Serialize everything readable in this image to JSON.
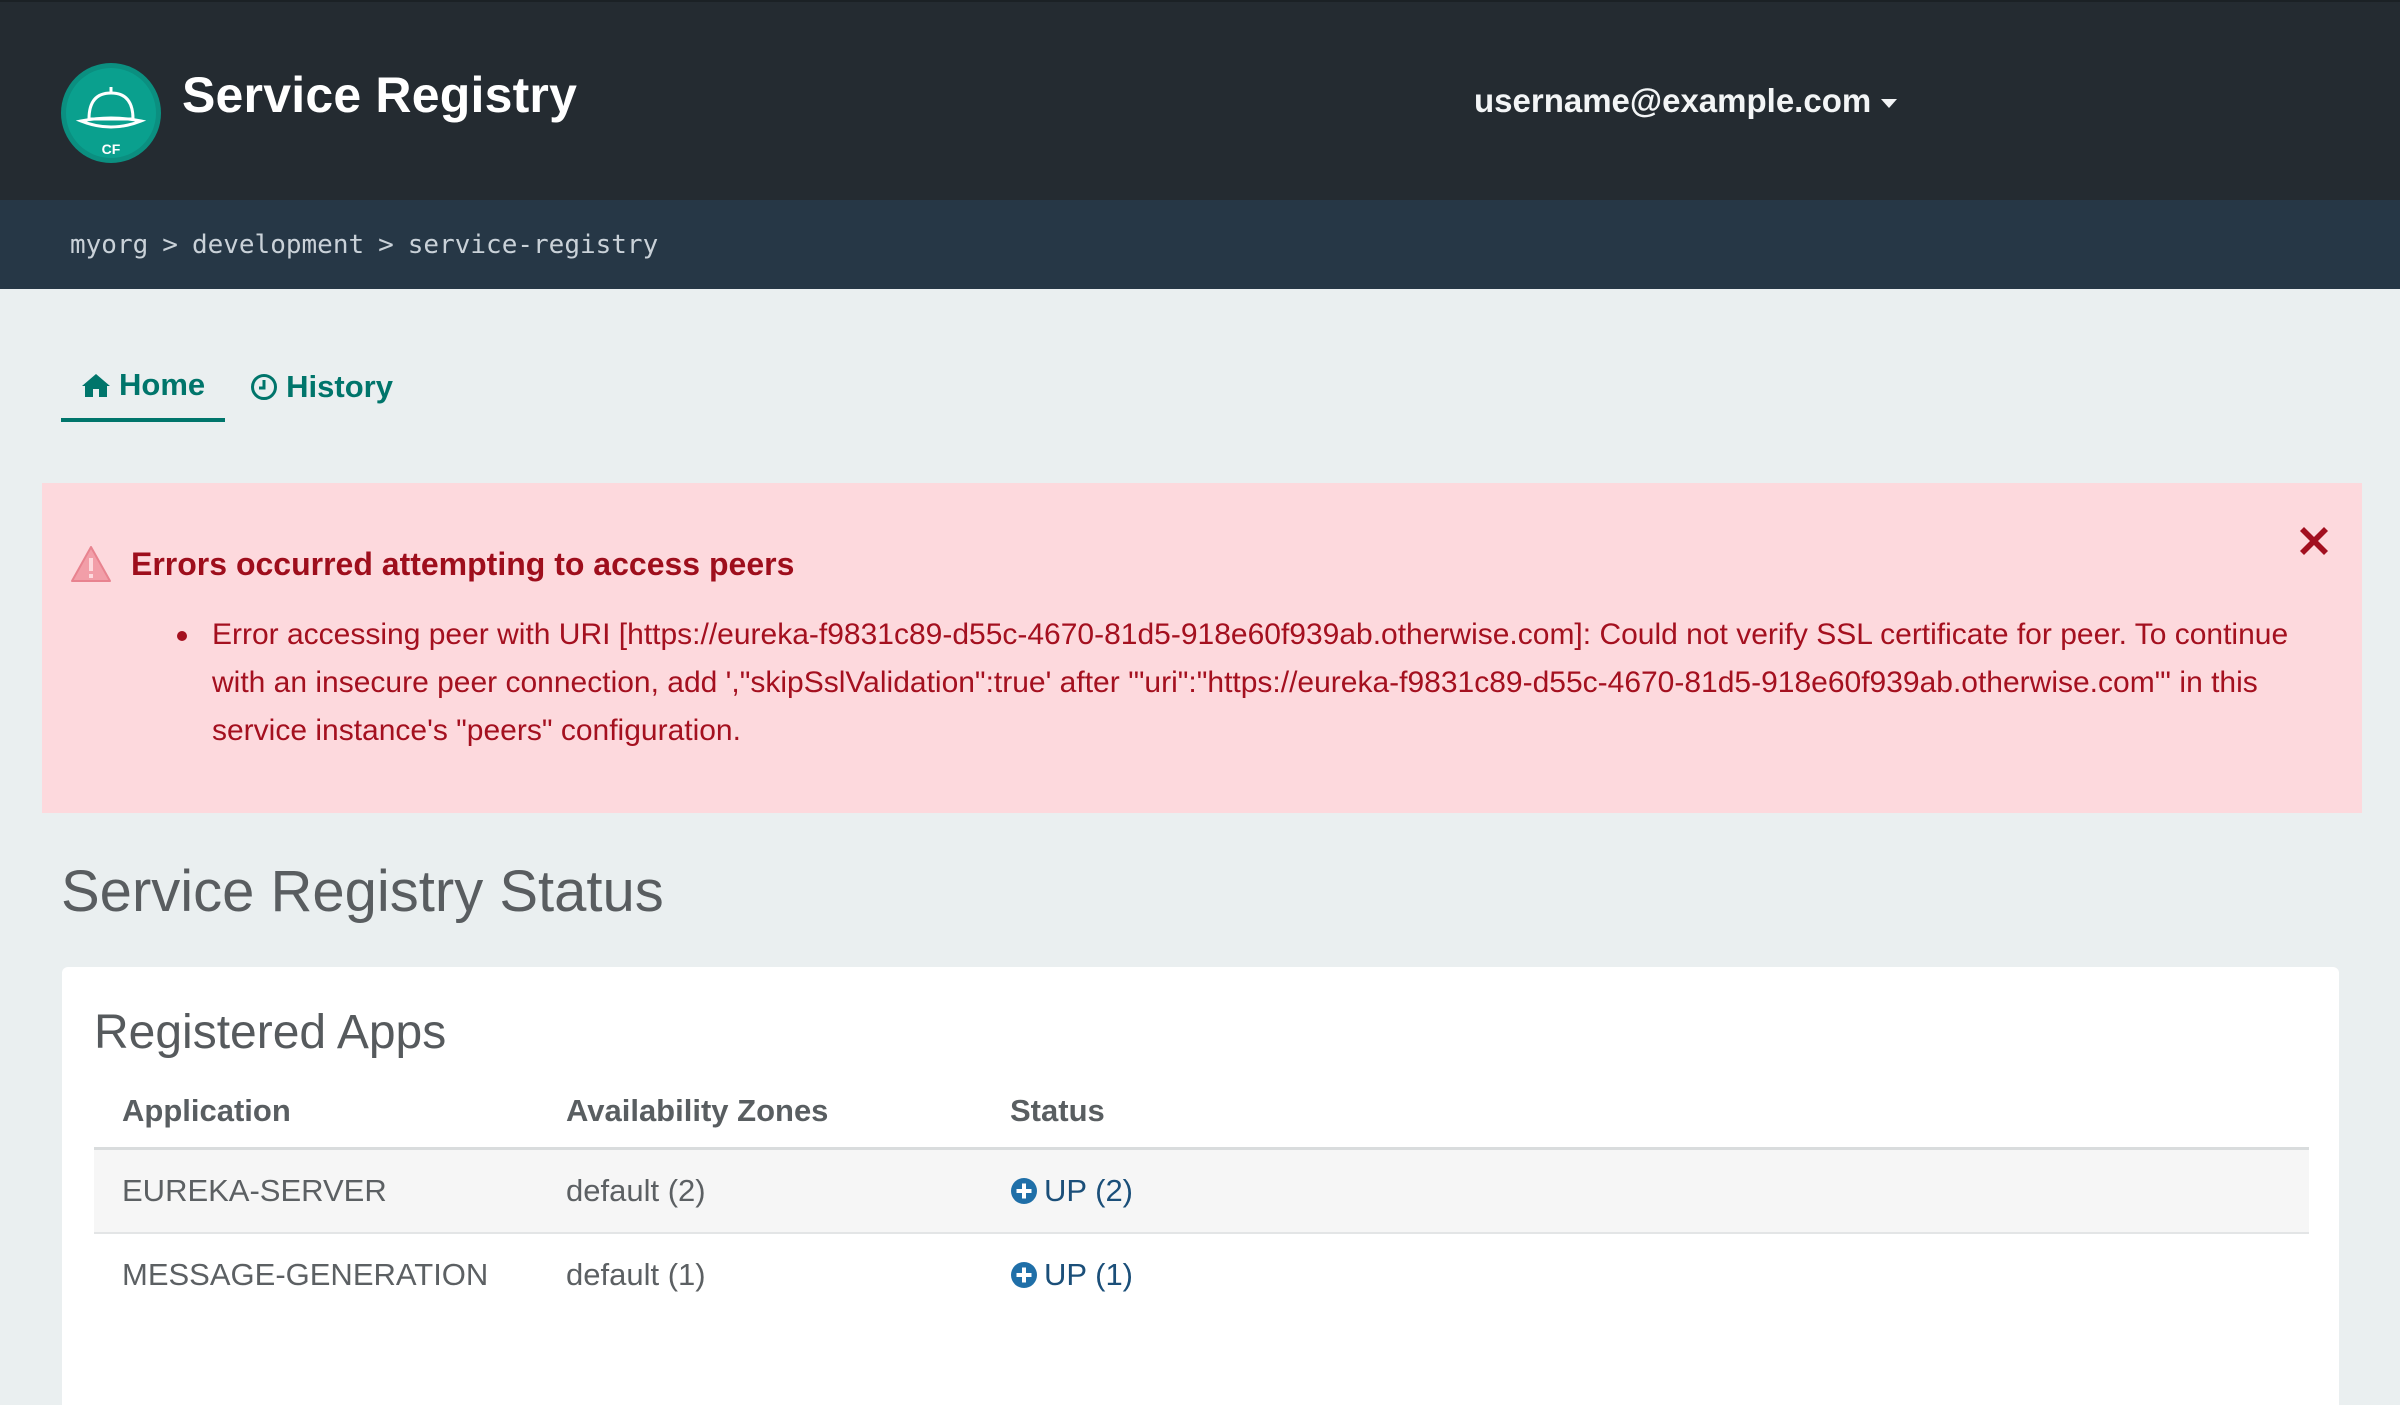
{
  "header": {
    "logo_text": "CF",
    "title": "Service Registry",
    "user": "username@example.com"
  },
  "breadcrumb": {
    "items": [
      "myorg",
      "development",
      "service-registry"
    ],
    "separator": ">"
  },
  "tabs": [
    {
      "label": "Home",
      "icon": "home-icon",
      "active": true
    },
    {
      "label": "History",
      "icon": "clock-icon",
      "active": false
    }
  ],
  "alert": {
    "title": "Errors occurred attempting to access peers",
    "messages": [
      "Error accessing peer with URI [https://eureka-f9831c89-d55c-4670-81d5-918e60f939ab.otherwise.com]: Could not verify SSL certificate for peer. To continue with an insecure peer connection, add ',\"skipSslValidation\":true' after '\"uri\":\"https://eureka-f9831c89-d55c-4670-81d5-918e60f939ab.otherwise.com\"' in this service instance's \"peers\" configuration."
    ],
    "icon": "warning-icon",
    "close_icon": "close-icon"
  },
  "main": {
    "title": "Service Registry Status",
    "registered_apps": {
      "title": "Registered Apps",
      "columns": [
        "Application",
        "Availability Zones",
        "Status"
      ],
      "rows": [
        {
          "application": "EUREKA-SERVER",
          "zones": "default (2)",
          "status": "UP (2)"
        },
        {
          "application": "MESSAGE-GENERATION",
          "zones": "default (1)",
          "status": "UP (1)"
        }
      ]
    }
  },
  "colors": {
    "header_bg": "#242b31",
    "breadcrumb_bg": "#263746",
    "page_bg": "#eaeff0",
    "accent": "#00756b",
    "alert_bg": "#fdd9dd",
    "alert_text": "#a4101f",
    "status_link": "#1b4f79"
  }
}
